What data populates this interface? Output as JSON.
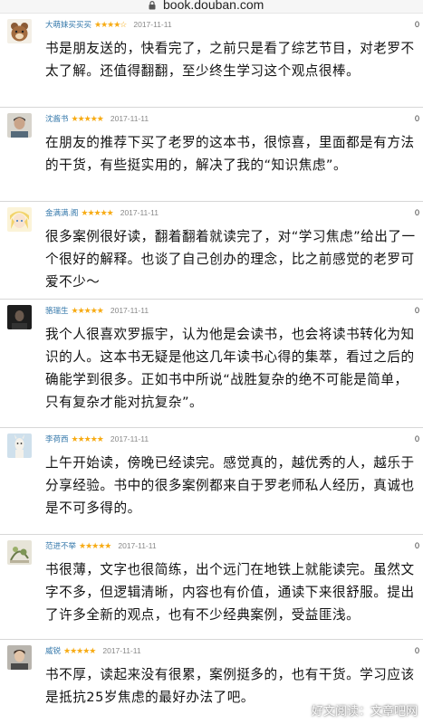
{
  "browser": {
    "url": "book.douban.com"
  },
  "reviews": [
    {
      "user": "大萌妹买买买",
      "stars": "★★★★☆",
      "date": "2017-11-11",
      "count": "0",
      "text": "书是朋友送的，快看完了，之前只是看了综艺节目，对老罗不太了解。还值得翻翻，至少终生学习这个观点很棒。"
    },
    {
      "user": "沈酱书",
      "stars": "★★★★★",
      "date": "2017-11-11",
      "count": "0",
      "text": "在朋友的推荐下买了老罗的这本书，很惊喜，里面都是有方法的干货，有些挺实用的，解决了我的“知识焦虑”。"
    },
    {
      "user": "金满满.阁",
      "stars": "★★★★★",
      "date": "2017-11-11",
      "count": "0",
      "text": "很多案例很好读，翻着翻着就读完了，对“学习焦虑”给出了一个很好的解释。也谈了自己创办的理念，比之前感觉的老罗可爱不少～"
    },
    {
      "user": "骆瑞生",
      "stars": "★★★★★",
      "date": "2017-11-11",
      "count": "0",
      "text": "我个人很喜欢罗振宇，认为他是会读书，也会将读书转化为知识的人。这本书无疑是他这几年读书心得的集萃，看过之后的确能学到很多。正如书中所说“战胜复杂的绝不可能是简单，只有复杂才能对抗复杂”。"
    },
    {
      "user": "李荷西",
      "stars": "★★★★★",
      "date": "2017-11-11",
      "count": "0",
      "text": "上午开始读，傍晚已经读完。感觉真的，越优秀的人，越乐于分享经验。书中的很多案例都来自于罗老师私人经历，真诚也是不可多得的。"
    },
    {
      "user": "范进不举",
      "stars": "★★★★★",
      "date": "2017-11-11",
      "count": "0",
      "text": "书很薄，文字也很简练，出个远门在地铁上就能读完。虽然文字不多，但逻辑清晰，内容也有价值，通读下来很舒服。提出了许多全新的观点，也有不少经典案例，受益匪浅。"
    },
    {
      "user": "威锐",
      "stars": "★★★★★",
      "date": "2017-11-11",
      "count": "0",
      "text": "书不厚，读起来没有很累，案例挺多的，也有干货。学习应该是抵抗25岁焦虑的最好办法了吧。"
    }
  ],
  "watermark": "好文阅读：文章吧网",
  "colors": {
    "username": "#3377aa",
    "star": "#f7ab14",
    "divider": "#d7d7d7"
  },
  "icons": [
    "lock-icon",
    "avatar-bear",
    "avatar-man",
    "avatar-anime",
    "avatar-dark",
    "avatar-llama",
    "avatar-sketch",
    "avatar-person"
  ]
}
